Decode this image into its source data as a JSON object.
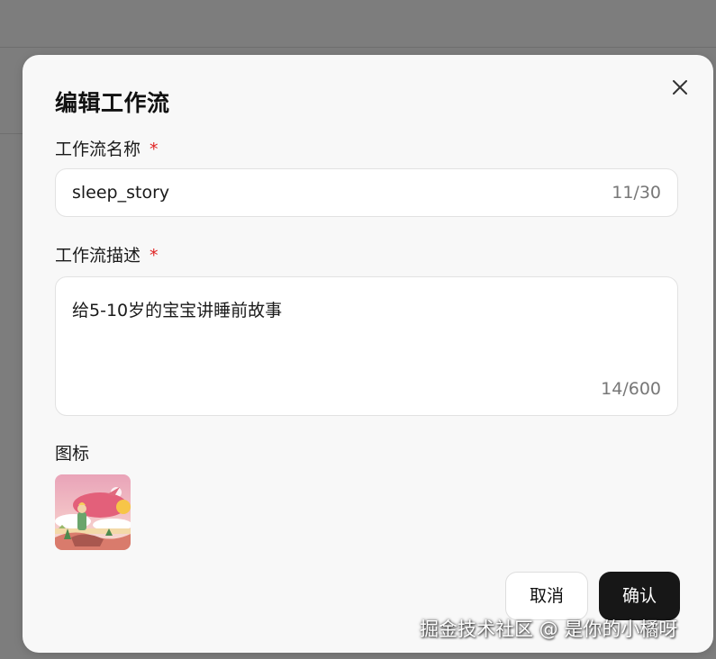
{
  "dialog": {
    "title": "编辑工作流",
    "close_icon": "close-icon",
    "name_field": {
      "label": "工作流名称",
      "required_mark": "*",
      "value": "sleep_story",
      "counter": "11/30"
    },
    "description_field": {
      "label": "工作流描述",
      "required_mark": "*",
      "value": "给5-10岁的宝宝讲睡前故事",
      "counter": "14/600"
    },
    "icon_section": {
      "label": "图标",
      "image": "illustration-icon"
    },
    "buttons": {
      "cancel_label": "取消",
      "confirm_label": "确认"
    }
  },
  "watermark": "掘金技术社区 @ 是你的小橘呀",
  "colors": {
    "overlay": "#7d7d7d",
    "dialog_bg": "#f8f8f8",
    "required": "#e02424",
    "primary_button": "#171717"
  }
}
